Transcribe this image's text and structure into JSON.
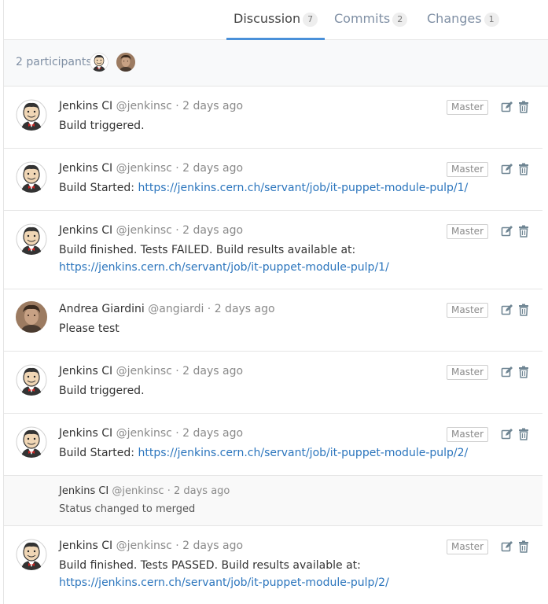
{
  "tabs": [
    {
      "label": "Discussion",
      "count": "7"
    },
    {
      "label": "Commits",
      "count": "2"
    },
    {
      "label": "Changes",
      "count": "1"
    }
  ],
  "participants": {
    "label": "2 participants"
  },
  "notes": [
    {
      "author": "Jenkins CI",
      "handle": "@jenkinsc · 2 days ago",
      "role": "Master",
      "text": "Build triggered."
    },
    {
      "author": "Jenkins CI",
      "handle": "@jenkinsc · 2 days ago",
      "role": "Master",
      "text": "Build Started: ",
      "link": "https://jenkins.cern.ch/servant/job/it-puppet-module-pulp/1/"
    },
    {
      "author": "Jenkins CI",
      "handle": "@jenkinsc · 2 days ago",
      "role": "Master",
      "text": "Build finished. Tests FAILED. Build results available at: ",
      "link": "https://jenkins.cern.ch/servant/job/it-puppet-module-pulp/1/"
    },
    {
      "author": "Andrea Giardini",
      "handle": "@angiardi · 2 days ago",
      "role": "Master",
      "text": "Please test"
    },
    {
      "author": "Jenkins CI",
      "handle": "@jenkinsc · 2 days ago",
      "role": "Master",
      "text": "Build triggered."
    },
    {
      "author": "Jenkins CI",
      "handle": "@jenkinsc · 2 days ago",
      "role": "Master",
      "text": "Build Started: ",
      "link": "https://jenkins.cern.ch/servant/job/it-puppet-module-pulp/2/"
    },
    {
      "author": "Jenkins CI",
      "handle": "@jenkinsc · 2 days ago",
      "text": "Status changed to merged"
    },
    {
      "author": "Jenkins CI",
      "handle": "@jenkinsc · 2 days ago",
      "role": "Master",
      "text": "Build finished. Tests PASSED. Build results available at: ",
      "link": "https://jenkins.cern.ch/servant/job/it-puppet-module-pulp/2/"
    }
  ],
  "icons": {
    "edit": "edit-icon",
    "delete": "trash-icon",
    "jenkins_avatar": "jenkins-butler-avatar",
    "user_avatar": "user-photo-avatar"
  },
  "colors": {
    "link": "#2b75bd",
    "active_tab": "#4a90d9"
  }
}
